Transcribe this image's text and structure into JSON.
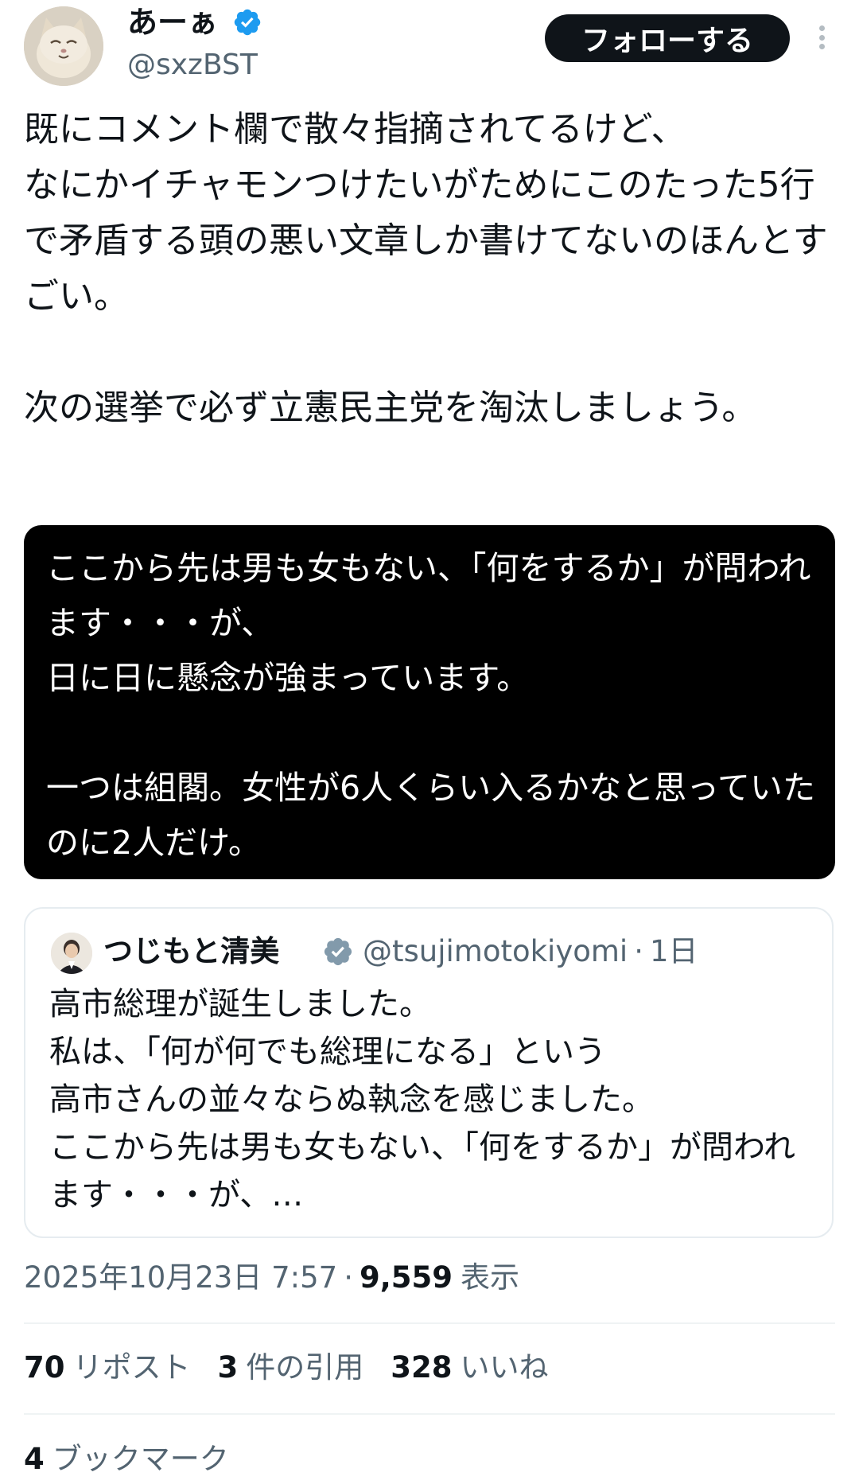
{
  "author": {
    "display_name": "あーぁ",
    "handle": "@sxzBST",
    "verified": true,
    "avatar_icon": "cat-avatar-icon"
  },
  "header": {
    "follow_label": "フォローする",
    "more_icon": "more-vertical-icon"
  },
  "tweet": {
    "text": "既にコメント欄で散々指摘されてるけど、\nなにかイチャモンつけたいがためにこのたった5行で矛盾する頭の悪い文章しか書けてないのほんとすごい。\n\n次の選挙で必ず立憲民主党を淘汰しましょう。"
  },
  "media": {
    "text": "ここから先は男も女もない、「何をするか」が問われます・・・が、\n日に日に懸念が強まっています。\n\n一つは組閣。女性が6人くらい入るかなと思っていたのに2人だけ。"
  },
  "quote": {
    "display_name": "つじもと清美",
    "handle": "@tsujimotokiyomi",
    "time": "1日",
    "separator": "·",
    "text": "高市総理が誕生しました。\n私は、「何が何でも総理になる」という\n高市さんの並々ならぬ執念を感じました。\nここから先は男も女もない、「何をするか」が問われます・・・が、…"
  },
  "meta": {
    "timestamp": "2025年10月23日 7:57",
    "separator": "·",
    "views_count": "9,559",
    "views_label": "表示"
  },
  "stats": {
    "reposts_count": "70",
    "reposts_label": "リポスト",
    "quotes_count": "3",
    "quotes_label": "件の引用",
    "likes_count": "328",
    "likes_label": "いいね",
    "bookmarks_count": "4",
    "bookmarks_label": "ブックマーク"
  },
  "colors": {
    "text_primary": "#0f1419",
    "text_secondary": "#536471",
    "verified_blue": "#1d9bf0",
    "quote_verified_gray": "#829aab",
    "button_bg": "#0f1419",
    "media_bg": "#000000"
  }
}
